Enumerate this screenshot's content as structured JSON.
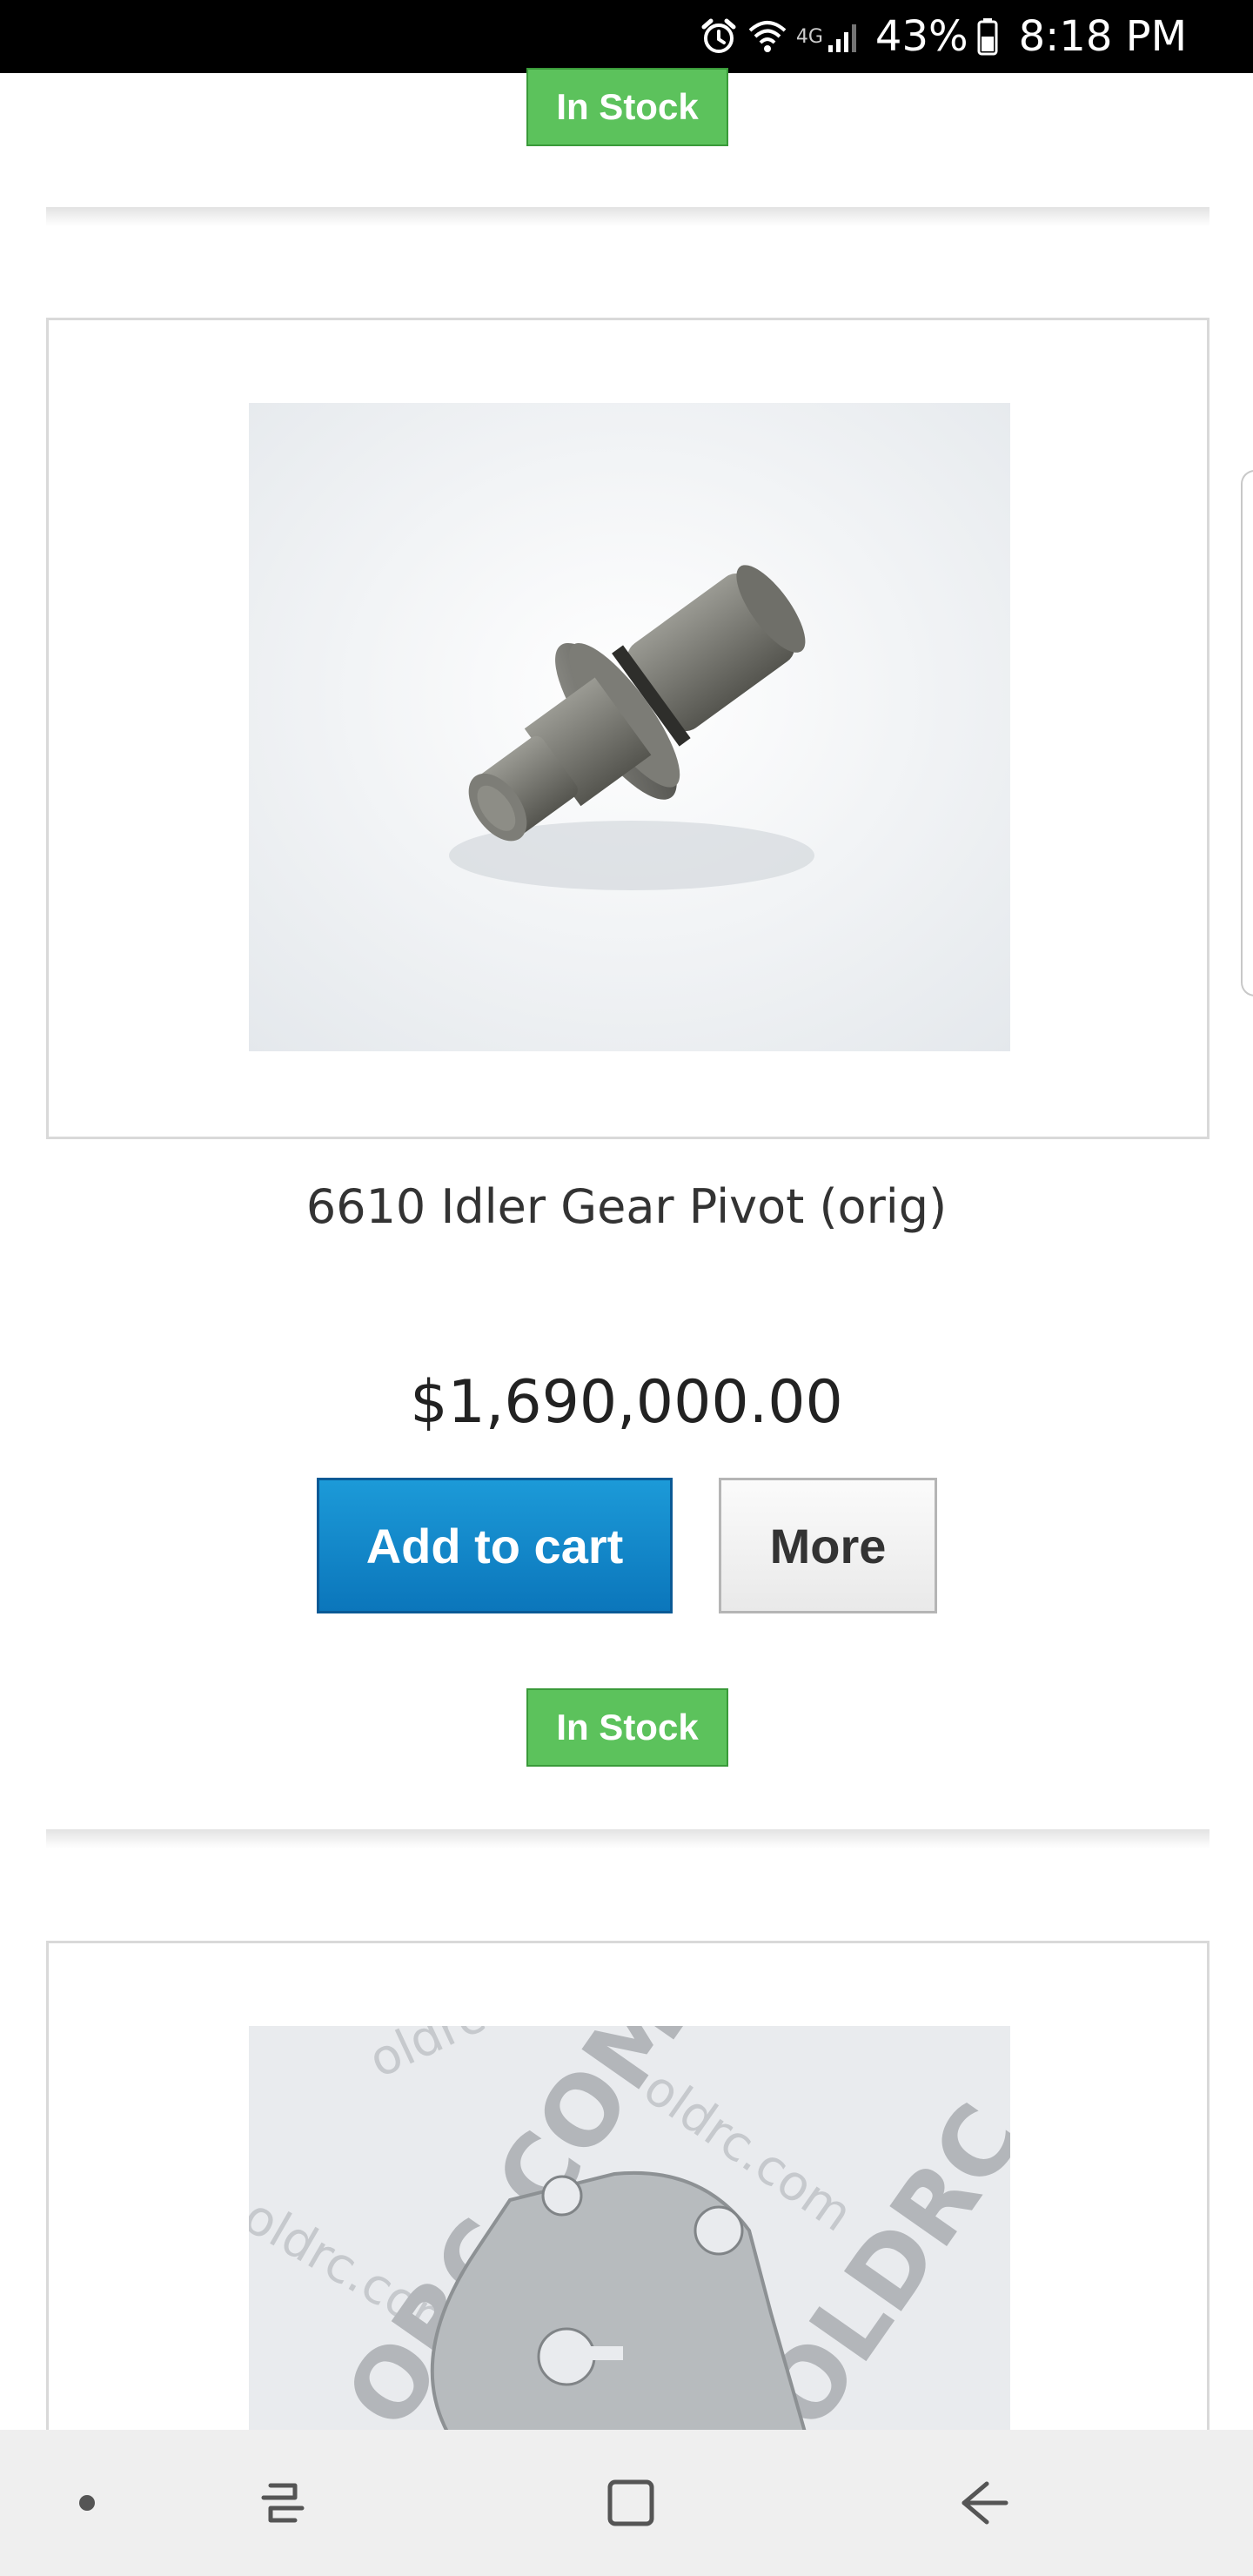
{
  "status_bar": {
    "network_type": "4G",
    "battery_percent": "43%",
    "time": "8:18 PM"
  },
  "previous_product": {
    "stock_label": "In Stock"
  },
  "product": {
    "title": "6610 Idler Gear Pivot (orig)",
    "price": "$1,690,000.00",
    "add_to_cart_label": "Add to cart",
    "more_label": "More",
    "stock_label": "In Stock"
  },
  "next_product": {
    "watermark": "oldrc.com"
  },
  "colors": {
    "in_stock_green": "#5cc25c",
    "add_to_cart_blue": "#0b76bb"
  },
  "nav_bar": {
    "icons": [
      "dot-icon",
      "recent-apps-icon",
      "home-icon",
      "back-icon"
    ]
  }
}
